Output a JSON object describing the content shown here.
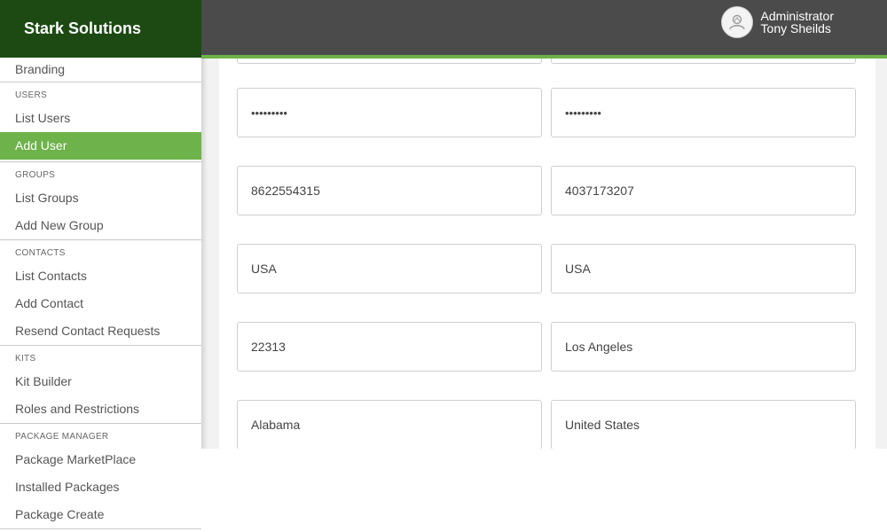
{
  "brand": {
    "name": "Stark Solutions"
  },
  "user": {
    "role": "Administrator",
    "name": "Tony Sheilds"
  },
  "sidebar": {
    "top_item": "Branding",
    "sections": [
      {
        "header": "USERS",
        "items": [
          "List Users",
          "Add User"
        ],
        "active": "Add User"
      },
      {
        "header": "GROUPS",
        "items": [
          "List Groups",
          "Add New Group"
        ]
      },
      {
        "header": "CONTACTS",
        "items": [
          "List Contacts",
          "Add Contact",
          "Resend Contact Requests"
        ]
      },
      {
        "header": "KITS",
        "items": [
          "Kit Builder",
          "Roles and Restrictions"
        ]
      },
      {
        "header": "PACKAGE MANAGER",
        "items": [
          "Package MarketPlace",
          "Installed Packages",
          "Package Create"
        ]
      }
    ]
  },
  "form": {
    "password": "•••••••••",
    "confirm_password": "•••••••••",
    "phone": "8622554315",
    "mobile": "4037173207",
    "country_1": "USA",
    "country_2": "USA",
    "zip": "22313",
    "city": "Los Angeles",
    "state": "Alabama",
    "country_name": "United States"
  },
  "colors": {
    "brand_bg": "#1c4a12",
    "accent": "#6db24a",
    "topbar": "#4b4b4b"
  },
  "icons": {
    "avatar": "user-avatar-icon"
  }
}
